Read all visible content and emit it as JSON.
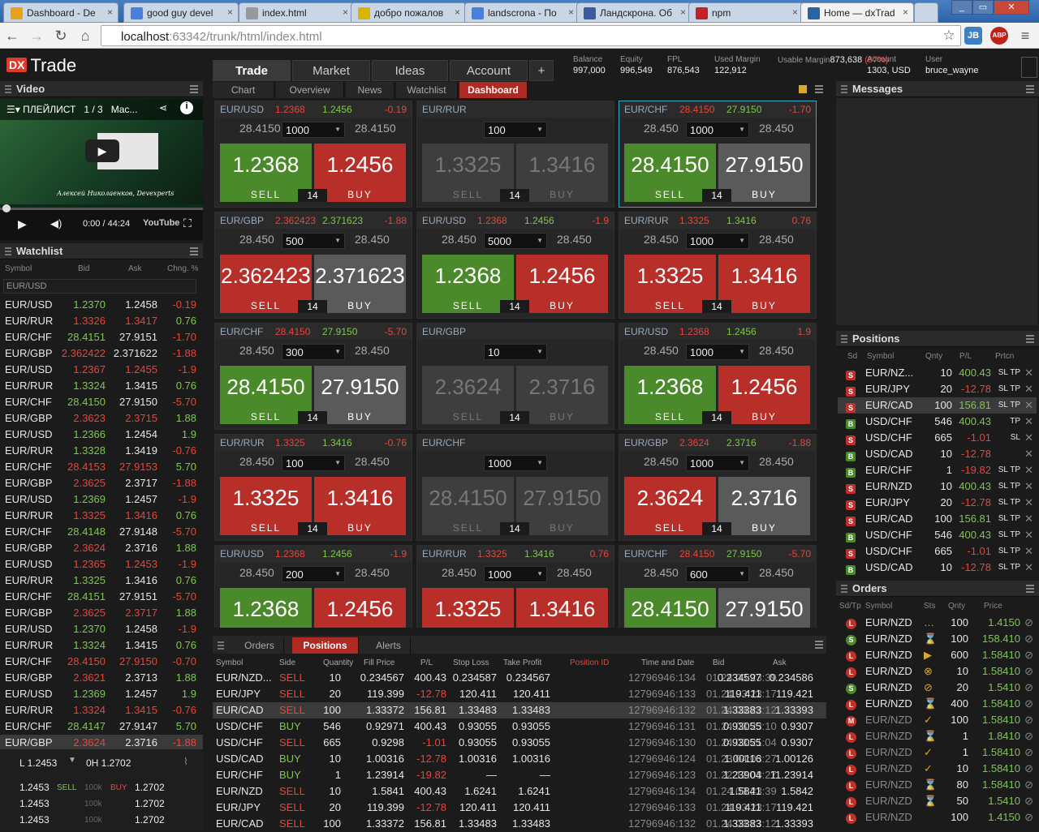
{
  "browser": {
    "tabs": [
      {
        "title": "Dashboard - De",
        "icon": "dx-icon",
        "color": "#e8a21a"
      },
      {
        "title": "good guy devel",
        "icon": "google-icon",
        "color": "#4a7fe0"
      },
      {
        "title": "index.html",
        "icon": "page-icon",
        "color": "#999999"
      },
      {
        "title": "добро пожалов",
        "icon": "folder-icon",
        "color": "#d9b400"
      },
      {
        "title": "landscrona - По",
        "icon": "google-icon",
        "color": "#4a7fe0"
      },
      {
        "title": "Ландскрона. Об",
        "icon": "wiki-icon",
        "color": "#3a5ba0"
      },
      {
        "title": "npm",
        "icon": "npm-icon",
        "color": "#c12127"
      },
      {
        "title": "Home — dxTrad",
        "icon": "dx-icon",
        "color": "#2a64a8"
      }
    ],
    "url_host": "localhost",
    "url_rest": ":63342/trunk/html/index.html",
    "ext1": "JB",
    "ext2": "ABP"
  },
  "app": {
    "logo": "Trade",
    "logo_badge": "DX",
    "main_tabs": [
      "Trade",
      "Market",
      "Ideas",
      "Account",
      "+"
    ],
    "stats": [
      {
        "label": "Balance",
        "value": "997,000"
      },
      {
        "label": "Equity",
        "value": "996,549"
      },
      {
        "label": "FPL",
        "value": "876,543"
      },
      {
        "label": "Used Margin",
        "value": "122,912"
      },
      {
        "label": "Usable Margin",
        "value": "873,638",
        "extra": "(87%)"
      },
      {
        "label": "Account",
        "value": "1303, USD"
      },
      {
        "label": "User",
        "value": "bruce_wayne"
      }
    ],
    "sub_tabs": [
      "Chart",
      "Overview",
      "News",
      "Watchlist",
      "Dashboard"
    ]
  },
  "video": {
    "header": "Video",
    "playlist": "ПЛЕЙЛИСТ",
    "count": "1 / 3",
    "title": "Mac...",
    "caption": "Алексей Николаенков, Devexperts",
    "time": "0:00 / 44:24",
    "yt": "YouTube"
  },
  "watchlist": {
    "header": "Watchlist",
    "cols": [
      "Symbol",
      "Bid",
      "Ask",
      "Chng. %"
    ],
    "filter": "EUR/USD",
    "rows": [
      [
        "EUR/USD",
        "1.2370",
        "1.2458",
        "-0.19"
      ],
      [
        "EUR/RUR",
        "1.3326",
        "1.3417",
        "0.76"
      ],
      [
        "EUR/CHF",
        "28.4151",
        "27.9151",
        "-1.70"
      ],
      [
        "EUR/GBP",
        "2.362422",
        "2.371622",
        "-1.88"
      ],
      [
        "EUR/USD",
        "1.2367",
        "1.2455",
        "-1.9"
      ],
      [
        "EUR/RUR",
        "1.3324",
        "1.3415",
        "0.76"
      ],
      [
        "EUR/CHF",
        "28.4150",
        "27.9150",
        "-5.70"
      ],
      [
        "EUR/GBP",
        "2.3623",
        "2.3715",
        "1.88"
      ],
      [
        "EUR/USD",
        "1.2366",
        "1.2454",
        "1.9"
      ],
      [
        "EUR/RUR",
        "1.3328",
        "1.3419",
        "-0.76"
      ],
      [
        "EUR/CHF",
        "28.4153",
        "27.9153",
        "5.70"
      ],
      [
        "EUR/GBP",
        "2.3625",
        "2.3717",
        "-1.88"
      ],
      [
        "EUR/USD",
        "1.2369",
        "1.2457",
        "-1.9"
      ],
      [
        "EUR/RUR",
        "1.3325",
        "1.3416",
        "0.76"
      ],
      [
        "EUR/CHF",
        "28.4148",
        "27.9148",
        "-5.70"
      ],
      [
        "EUR/GBP",
        "2.3624",
        "2.3716",
        "1.88"
      ],
      [
        "EUR/USD",
        "1.2365",
        "1.2453",
        "-1.9"
      ],
      [
        "EUR/RUR",
        "1.3325",
        "1.3416",
        "0.76"
      ],
      [
        "EUR/CHF",
        "28.4151",
        "27.9151",
        "-5.70"
      ],
      [
        "EUR/GBP",
        "2.3625",
        "2.3717",
        "1.88"
      ],
      [
        "EUR/USD",
        "1.2370",
        "1.2458",
        "-1.9"
      ],
      [
        "EUR/RUR",
        "1.3324",
        "1.3415",
        "0.76"
      ],
      [
        "EUR/CHF",
        "28.4150",
        "27.9150",
        "-0.70"
      ],
      [
        "EUR/GBP",
        "2.3621",
        "2.3713",
        "1.88"
      ],
      [
        "EUR/USD",
        "1.2369",
        "1.2457",
        "1.9"
      ],
      [
        "EUR/RUR",
        "1.3324",
        "1.3415",
        "-0.76"
      ],
      [
        "EUR/CHF",
        "28.4147",
        "27.9147",
        "5.70"
      ],
      [
        "EUR/GBP",
        "2.3624",
        "2.3716",
        "-1.88"
      ]
    ],
    "bottom": {
      "low": "L 1.2453",
      "high": "0H 1.2702",
      "sell": "SELL",
      "buy": "BUY",
      "ladder": [
        [
          "1.2453",
          "100k",
          "1.2702"
        ],
        [
          "1.2453",
          "100k",
          "1.2702"
        ],
        [
          "1.2453",
          "100k",
          "1.2702"
        ]
      ]
    }
  },
  "tiles": [
    {
      "sym": "EUR/USD",
      "p1": "1.2368",
      "p2": "1.2456",
      "chg": "-0.19",
      "l": "28.4150",
      "r": "28.4150",
      "qty": "1000",
      "sell": [
        "1.2",
        "36",
        "8"
      ],
      "buy": [
        "1.2",
        "45",
        "6"
      ],
      "st": "gr",
      "sel": false
    },
    {
      "sym": "EUR/RUR",
      "p1": "",
      "p2": "",
      "chg": "",
      "l": "",
      "r": "",
      "qty": "100",
      "sell": [
        "1.3",
        "32",
        "5"
      ],
      "buy": [
        "1.3",
        "41",
        "6"
      ],
      "st": "dd",
      "sel": false
    },
    {
      "sym": "EUR/CHF",
      "p1": "28.4150",
      "p2": "27.9150",
      "chg": "-1.70",
      "l": "28.450",
      "r": "28.450",
      "qty": "1000",
      "sell": [
        "28.4",
        "15",
        "0"
      ],
      "buy": [
        "27.9",
        "15",
        "0"
      ],
      "st": "gd",
      "sel": true
    },
    {
      "sym": "EUR/GBP",
      "p1": "2.362423",
      "p2": "2.371623",
      "chg": "-1.88",
      "l": "28.450",
      "r": "28.450",
      "qty": "500",
      "sell": [
        "2.3624",
        "23",
        ""
      ],
      "buy": [
        "2.3716",
        "23",
        ""
      ],
      "st": "rd",
      "sel": false
    },
    {
      "sym": "EUR/USD",
      "p1": "1.2368",
      "p2": "1.2456",
      "chg": "-1.9",
      "l": "28.450",
      "r": "28.450",
      "qty": "5000",
      "sell": [
        "1.2",
        "36",
        "8"
      ],
      "buy": [
        "1.2",
        "45",
        "6"
      ],
      "st": "gr",
      "sel": false
    },
    {
      "sym": "EUR/RUR",
      "p1": "1.3325",
      "p2": "1.3416",
      "chg": "0.76",
      "l": "28.450",
      "r": "28.450",
      "qty": "1000",
      "sell": [
        "1.3",
        "32",
        "5"
      ],
      "buy": [
        "1.3",
        "41",
        "6"
      ],
      "st": "rr",
      "sel": false
    },
    {
      "sym": "EUR/CHF",
      "p1": "28.4150",
      "p2": "27.9150",
      "chg": "-5.70",
      "l": "28.450",
      "r": "28.450",
      "qty": "300",
      "sell": [
        "28.4",
        "15",
        "0"
      ],
      "buy": [
        "27.9",
        "15",
        "0"
      ],
      "st": "gd",
      "sel": false
    },
    {
      "sym": "EUR/GBP",
      "p1": "",
      "p2": "",
      "chg": "",
      "l": "",
      "r": "",
      "qty": "10",
      "sell": [
        "2.36",
        "24",
        ""
      ],
      "buy": [
        "2.37",
        "16",
        ""
      ],
      "st": "dd",
      "sel": false
    },
    {
      "sym": "EUR/USD",
      "p1": "1.2368",
      "p2": "1.2456",
      "chg": "1.9",
      "l": "28.450",
      "r": "28.450",
      "qty": "1000",
      "sell": [
        "1.2",
        "36",
        "8"
      ],
      "buy": [
        "1.2",
        "45",
        "6"
      ],
      "st": "gr",
      "sel": false
    },
    {
      "sym": "EUR/RUR",
      "p1": "1.3325",
      "p2": "1.3416",
      "chg": "-0.76",
      "l": "28.450",
      "r": "28.450",
      "qty": "100",
      "sell": [
        "1.3",
        "32",
        "5"
      ],
      "buy": [
        "1.3",
        "41",
        "6"
      ],
      "st": "rr",
      "sel": false
    },
    {
      "sym": "EUR/CHF",
      "p1": "",
      "p2": "",
      "chg": "",
      "l": "",
      "r": "",
      "qty": "1000",
      "sell": [
        "28.4",
        "15",
        "0"
      ],
      "buy": [
        "27.9",
        "15",
        "0"
      ],
      "st": "dd",
      "sel": false
    },
    {
      "sym": "EUR/GBP",
      "p1": "2.3624",
      "p2": "2.3716",
      "chg": "-1.88",
      "l": "28.450",
      "r": "28.450",
      "qty": "1000",
      "sell": [
        "2.36",
        "24",
        ""
      ],
      "buy": [
        "2.37",
        "16",
        ""
      ],
      "st": "rd",
      "sel": false
    },
    {
      "sym": "EUR/USD",
      "p1": "1.2368",
      "p2": "1.2456",
      "chg": "-1.9",
      "l": "28.450",
      "r": "28.450",
      "qty": "200",
      "sell": [
        "1.2",
        "36",
        "8"
      ],
      "buy": [
        "1.2",
        "45",
        "6"
      ],
      "st": "gr",
      "sel": false
    },
    {
      "sym": "EUR/RUR",
      "p1": "1.3325",
      "p2": "1.3416",
      "chg": "0.76",
      "l": "28.450",
      "r": "28.450",
      "qty": "1000",
      "sell": [
        "1.3",
        "32",
        "5"
      ],
      "buy": [
        "1.3",
        "41",
        "6"
      ],
      "st": "rr",
      "sel": false
    },
    {
      "sym": "EUR/CHF",
      "p1": "28.4150",
      "p2": "27.9150",
      "chg": "-5.70",
      "l": "28.450",
      "r": "28.450",
      "qty": "600",
      "sell": [
        "28.4",
        "15",
        "0"
      ],
      "buy": [
        "27.9",
        "15",
        "0"
      ],
      "st": "gd",
      "sel": false
    }
  ],
  "tile_labels": {
    "sell": "SELL",
    "buy": "BUY",
    "spread": "14"
  },
  "bottom_grid": {
    "tabs": [
      "Orders",
      "Positions",
      "Alerts"
    ],
    "cols": [
      "Symbol",
      "Side",
      "Quantity",
      "Fill Price",
      "P/L",
      "Stop Loss",
      "Take Profit",
      "Position ID",
      "Time and Date",
      "Bid",
      "Ask"
    ],
    "rows": [
      [
        "EUR/NZD...",
        "SELL",
        "10",
        "0.234567",
        "400.43",
        "0.234587",
        "0.234567",
        "12796946:134",
        "01.24 03:23:39",
        "0.234597",
        "0.234586"
      ],
      [
        "EUR/JPY",
        "SELL",
        "20",
        "119.399",
        "-12.78",
        "120.411",
        "120.411",
        "12796946:133",
        "01.24 03:23:17",
        "119.411",
        "119.421"
      ],
      [
        "EUR/CAD",
        "SELL",
        "100",
        "1.33372",
        "156.81",
        "1.33483",
        "1.33483",
        "12796946:132",
        "01.24 03:23:12",
        "1.33383",
        "1.33393"
      ],
      [
        "USD/CHF",
        "BUY",
        "546",
        "0.92971",
        "400.43",
        "0.93055",
        "0.93055",
        "12796946:131",
        "01.24 03:23:10",
        "0.93055",
        "0.9307"
      ],
      [
        "USD/CHF",
        "SELL",
        "665",
        "0.9298",
        "-1.01",
        "0.93055",
        "0.93055",
        "12796946:130",
        "01.24 03:21:04",
        "0.93055",
        "0.9307"
      ],
      [
        "USD/CAD",
        "BUY",
        "10",
        "1.00316",
        "-12.78",
        "1.00316",
        "1.00316",
        "12796946:124",
        "01.23 04:03:27",
        "1.00116",
        "1.00126"
      ],
      [
        "EUR/CHF",
        "BUY",
        "1",
        "1.23914",
        "-19.82",
        "—",
        "—",
        "12796946:123",
        "01.22 12:03:27",
        "1.23904",
        "11.23914"
      ],
      [
        "EUR/NZD",
        "SELL",
        "10",
        "1.5841",
        "400.43",
        "1.6241",
        "1.6241",
        "12796946:134",
        "01.24 03:23:39",
        "1.5841",
        "1.5842"
      ],
      [
        "EUR/JPY",
        "SELL",
        "20",
        "119.399",
        "-12.78",
        "120.411",
        "120.411",
        "12796946:133",
        "01.24 03:23:17",
        "119.411",
        "119.421"
      ],
      [
        "EUR/CAD",
        "SELL",
        "100",
        "1.33372",
        "156.81",
        "1.33483",
        "1.33483",
        "12796946:132",
        "01.24 03:23:12",
        "1.33383",
        "1.33393"
      ]
    ]
  },
  "messages": {
    "header": "Messages"
  },
  "positions": {
    "header": "Positions",
    "cols": [
      "Sd",
      "Symbol",
      "Qnty",
      "P/L",
      "Prtcn"
    ],
    "rows": [
      [
        "S",
        "EUR/NZ...",
        "10",
        "400.43",
        "SL TP"
      ],
      [
        "S",
        "EUR/JPY",
        "20",
        "-12.78",
        "SL TP"
      ],
      [
        "S",
        "EUR/CAD",
        "100",
        "156.81",
        "SL TP"
      ],
      [
        "B",
        "USD/CHF",
        "546",
        "400.43",
        "TP"
      ],
      [
        "S",
        "USD/CHF",
        "665",
        "-1.01",
        "SL"
      ],
      [
        "B",
        "USD/CAD",
        "10",
        "-12.78",
        ""
      ],
      [
        "B",
        "EUR/CHF",
        "1",
        "-19.82",
        "SL TP"
      ],
      [
        "S",
        "EUR/NZD",
        "10",
        "400.43",
        "SL TP"
      ],
      [
        "S",
        "EUR/JPY",
        "20",
        "-12.78",
        "SL TP"
      ],
      [
        "S",
        "EUR/CAD",
        "100",
        "156.81",
        "SL TP"
      ],
      [
        "B",
        "USD/CHF",
        "546",
        "400.43",
        "SL TP"
      ],
      [
        "S",
        "USD/CHF",
        "665",
        "-1.01",
        "SL TP"
      ],
      [
        "B",
        "USD/CAD",
        "10",
        "-12.78",
        "SL TP"
      ]
    ]
  },
  "orders": {
    "header": "Orders",
    "cols": [
      "Sd/Tp",
      "Symbol",
      "Sts",
      "Qnty",
      "Price"
    ],
    "rows": [
      [
        "L",
        "EUR/NZD",
        "…",
        "100",
        "1.4150"
      ],
      [
        "S",
        "EUR/NZD",
        "⌛",
        "100",
        "158.410"
      ],
      [
        "L",
        "EUR/NZD",
        "▶",
        "600",
        "1.58410"
      ],
      [
        "L",
        "EUR/NZD",
        "⊗",
        "10",
        "1.58410"
      ],
      [
        "S",
        "EUR/NZD",
        "⊘",
        "20",
        "1.5410"
      ],
      [
        "L",
        "EUR/NZD",
        "⌛",
        "400",
        "1.58410"
      ],
      [
        "M",
        "EUR/NZD",
        "✓",
        "100",
        "1.58410"
      ],
      [
        "L",
        "EUR/NZD",
        "⌛",
        "1",
        "1.8410"
      ],
      [
        "L",
        "EUR/NZD",
        "✓",
        "1",
        "1.58410"
      ],
      [
        "L",
        "EUR/NZD",
        "✓",
        "10",
        "1.58410"
      ],
      [
        "L",
        "EUR/NZD",
        "⌛",
        "80",
        "1.58410"
      ],
      [
        "L",
        "EUR/NZD",
        "⌛",
        "50",
        "1.5410"
      ],
      [
        "L",
        "EUR/NZD",
        "",
        "100",
        "1.4150"
      ]
    ]
  }
}
